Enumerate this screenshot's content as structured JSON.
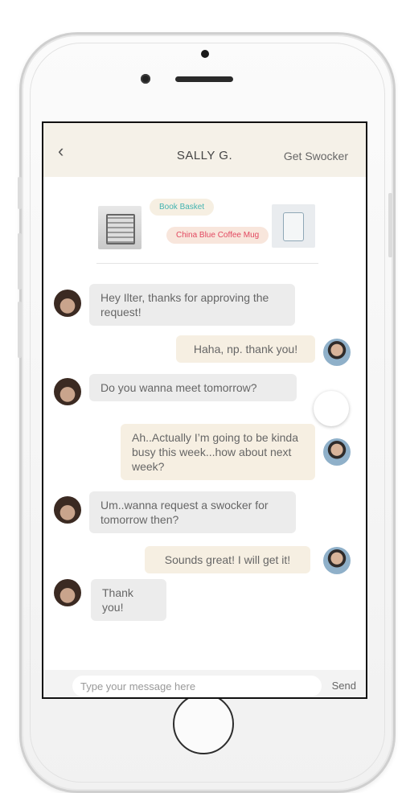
{
  "header": {
    "back": "‹",
    "title": "SALLY G.",
    "action": "Get Swocker"
  },
  "products": [
    {
      "label": "Book Basket",
      "color": "#43b3b0",
      "icon": "basket-thumbnail"
    },
    {
      "label": "China Blue Coffee Mug",
      "color": "#e24860",
      "icon": "mug-thumbnail"
    }
  ],
  "messages": [
    {
      "from": "sally",
      "text": "Hey Ilter, thanks for approving the request!"
    },
    {
      "from": "me",
      "text": "Haha, np. thank you!"
    },
    {
      "from": "sally",
      "text": "Do you wanna meet tomorrow?"
    },
    {
      "from": "me",
      "text": "Ah..Actually I’m going to be kinda busy this week...how about next week?"
    },
    {
      "from": "sally",
      "text": "Um..wanna request a swocker for tomorrow then?"
    },
    {
      "from": "me",
      "text": "Sounds great! I will get it!"
    },
    {
      "from": "sally",
      "text": "Thank you!"
    }
  ],
  "composer": {
    "placeholder": "Type your message here",
    "send": "Send"
  },
  "colors": {
    "header_bg": "#f5f1e8",
    "incoming_bubble": "#ececec",
    "outgoing_bubble": "#f6efe2"
  }
}
